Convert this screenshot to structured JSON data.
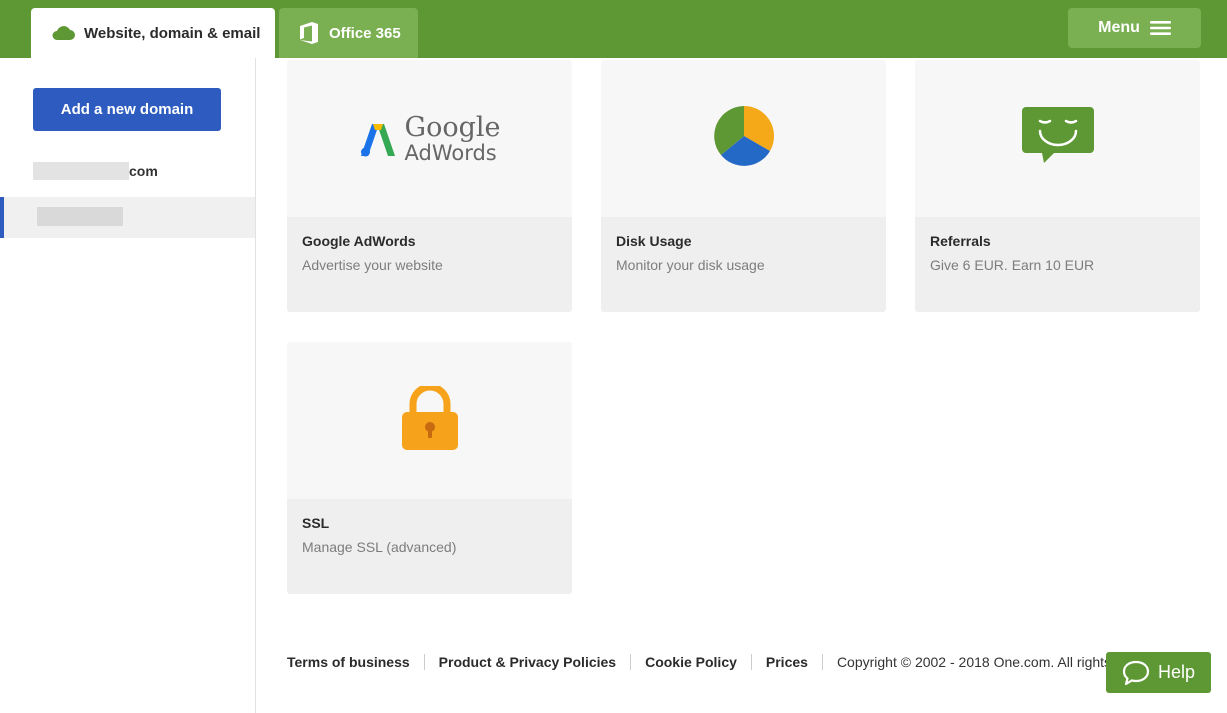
{
  "tabs": {
    "website": {
      "label": "Website, domain & email",
      "icon": "cloud-icon"
    },
    "office": {
      "label": "Office 365",
      "icon": "office-icon"
    }
  },
  "menu": {
    "label": "Menu",
    "icon": "hamburger-icon"
  },
  "sidebar": {
    "add_domain_label": "Add a new domain",
    "domains": [
      {
        "suffix": "com"
      }
    ]
  },
  "cards": [
    {
      "title": "Google AdWords",
      "subtitle": "Advertise your website",
      "logo_google": "Google",
      "logo_adwords": "AdWords"
    },
    {
      "title": "Disk Usage",
      "subtitle": "Monitor your disk usage",
      "icon": "pie-chart-icon"
    },
    {
      "title": "Referrals",
      "subtitle": "Give 6 EUR. Earn 10 EUR",
      "icon": "smiley-chat-icon"
    },
    {
      "title": "SSL",
      "subtitle": "Manage SSL (advanced)",
      "icon": "padlock-icon"
    }
  ],
  "footer": {
    "links": [
      "Terms of business",
      "Product & Privacy Policies",
      "Cookie Policy",
      "Prices"
    ],
    "copyright": "Copyright © 2002 - 2018 One.com. All rights reser"
  },
  "help": {
    "label": "Help",
    "icon": "chat-bubble-icon"
  },
  "colors": {
    "brand_green": "#5e9834",
    "light_green": "#7aaf52",
    "primary_blue": "#2d5bbf",
    "lock_orange": "#f7a21b"
  }
}
